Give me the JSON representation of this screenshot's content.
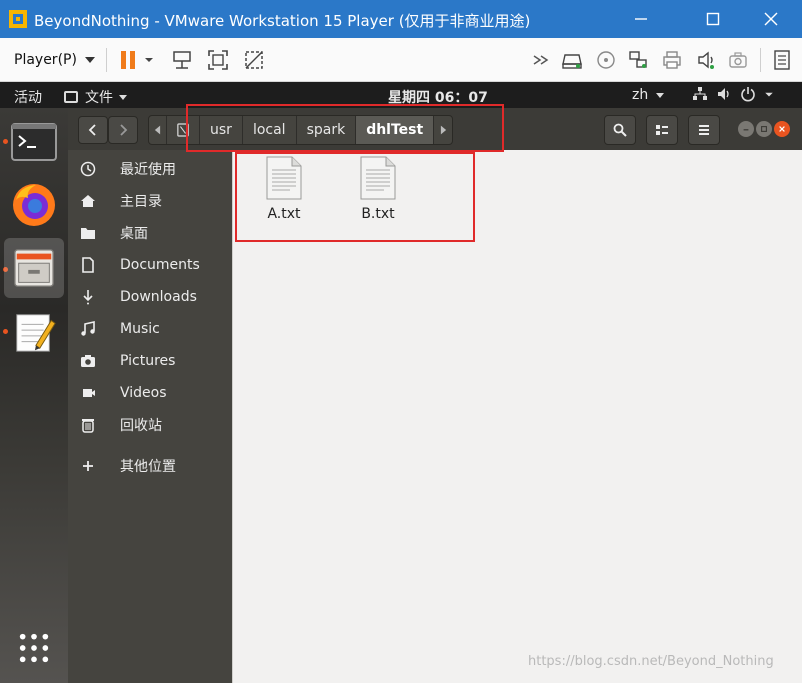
{
  "window": {
    "title": "BeyondNothing - VMware Workstation 15 Player (仅用于非商业用途)"
  },
  "toolbar": {
    "player_menu_label": "Player(P)"
  },
  "ubuntu_panel": {
    "activities": "活动",
    "app_menu": "文件",
    "clock": "星期四 06：07",
    "input_lang": "zh"
  },
  "file_manager": {
    "breadcrumbs": [
      "usr",
      "local",
      "spark",
      "dhlTest"
    ],
    "sidebar": [
      {
        "label": "最近使用",
        "icon": "clock-icon"
      },
      {
        "label": "主目录",
        "icon": "home-icon"
      },
      {
        "label": "桌面",
        "icon": "folder-icon"
      },
      {
        "label": "Documents",
        "icon": "document-icon"
      },
      {
        "label": "Downloads",
        "icon": "download-icon"
      },
      {
        "label": "Music",
        "icon": "music-icon"
      },
      {
        "label": "Pictures",
        "icon": "camera-icon"
      },
      {
        "label": "Videos",
        "icon": "video-icon"
      },
      {
        "label": "回收站",
        "icon": "trash-icon"
      },
      {
        "label": "其他位置",
        "icon": "plus-icon"
      }
    ],
    "files": [
      {
        "name": "A.txt",
        "icon": "text-file-icon"
      },
      {
        "name": "B.txt",
        "icon": "text-file-icon"
      }
    ]
  },
  "watermark": "https://blog.csdn.net/Beyond_Nothing",
  "colors": {
    "vm_titlebar": "#2b78c8",
    "ubuntu_accent": "#e95420",
    "highlight": "#e02a2a"
  }
}
